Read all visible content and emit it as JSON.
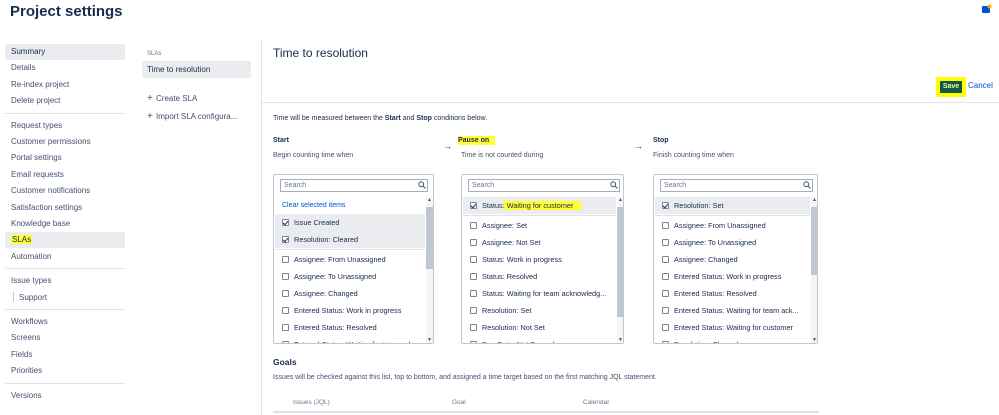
{
  "header": {
    "title": "Project settings",
    "help_icon": "notification-bell-icon"
  },
  "sidebar": {
    "groups": [
      [
        "Summary",
        "Details",
        "Re-index project",
        "Delete project"
      ],
      [
        "Request types",
        "Customer permissions",
        "Portal settings",
        "Email requests",
        "Customer notifications",
        "Satisfaction settings",
        "Knowledge base",
        "SLAs",
        "Automation"
      ],
      [
        "Issue types",
        "Support"
      ],
      [
        "Workflows",
        "Screens",
        "Fields",
        "Priorities"
      ],
      [
        "Versions"
      ]
    ]
  },
  "sla_panel": {
    "heading": "SLAs",
    "selected": "Time to resolution",
    "create": "Create SLA",
    "import": "Import SLA configura..."
  },
  "main": {
    "title": "Time to resolution",
    "save": "Save",
    "cancel": "Cancel",
    "intro_1": "Time will be measured between the ",
    "intro_start": "Start",
    "intro_2": " and ",
    "intro_stop": "Stop",
    "intro_3": " conditions below."
  },
  "conditions": {
    "start": {
      "title": "Start",
      "subtitle": "Begin counting time when",
      "search_placeholder": "Search",
      "clear": "Clear selected items",
      "selected": [
        "Issue Created",
        "Resolution: Cleared"
      ],
      "items": [
        "Assignee: From Unassigned",
        "Assignee: To Unassigned",
        "Assignee: Changed",
        "Entered Status: Work in progress",
        "Entered Status: Resolved",
        "Entered Status: Waiting for team ack..."
      ]
    },
    "pause": {
      "title": "Pause on",
      "subtitle": "Time is not counted during",
      "search_placeholder": "Search",
      "selected_prefix": "Status",
      "selected_rest": ": Waiting for customer",
      "items": [
        "Assignee: Set",
        "Assignee: Not Set",
        "Status: Work in progress",
        "Status: Resolved",
        "Status: Waiting for team acknowledg...",
        "Resolution: Set",
        "Resolution: Not Set",
        "Due Date: Not Passed"
      ]
    },
    "stop": {
      "title": "Stop",
      "subtitle": "Finish counting time when",
      "search_placeholder": "Search",
      "selected": [
        "Resolution: Set"
      ],
      "items": [
        "Assignee: From Unassigned",
        "Assignee: To Unassigned",
        "Assignee: Changed",
        "Entered Status: Work in progress",
        "Entered Status: Resolved",
        "Entered Status: Waiting for team ack...",
        "Entered Status: Waiting for customer",
        "Resolution: Cleared"
      ]
    }
  },
  "goals": {
    "title": "Goals",
    "description": "Issues will be checked against this list, top to bottom, and assigned a time target based on the first matching JQL statement.",
    "columns": [
      "Issues (JQL)",
      "Goal",
      "Calendar"
    ]
  },
  "colors": {
    "highlight": "#ffff33",
    "save_bg": "#0b5a4a",
    "link": "#0052cc"
  }
}
